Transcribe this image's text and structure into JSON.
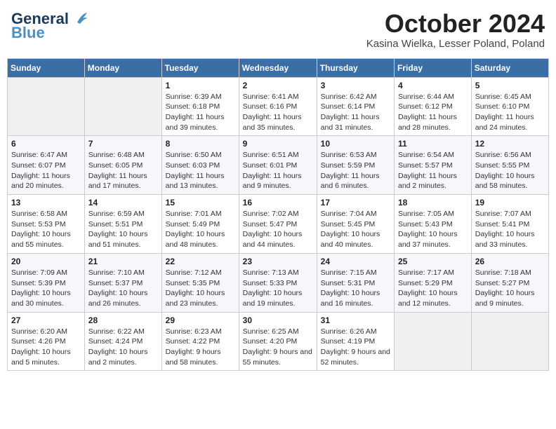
{
  "header": {
    "logo_general": "General",
    "logo_blue": "Blue",
    "month": "October 2024",
    "location": "Kasina Wielka, Lesser Poland, Poland"
  },
  "weekdays": [
    "Sunday",
    "Monday",
    "Tuesday",
    "Wednesday",
    "Thursday",
    "Friday",
    "Saturday"
  ],
  "weeks": [
    [
      {
        "day": "",
        "sunrise": "",
        "sunset": "",
        "daylight": ""
      },
      {
        "day": "",
        "sunrise": "",
        "sunset": "",
        "daylight": ""
      },
      {
        "day": "1",
        "sunrise": "Sunrise: 6:39 AM",
        "sunset": "Sunset: 6:18 PM",
        "daylight": "Daylight: 11 hours and 39 minutes."
      },
      {
        "day": "2",
        "sunrise": "Sunrise: 6:41 AM",
        "sunset": "Sunset: 6:16 PM",
        "daylight": "Daylight: 11 hours and 35 minutes."
      },
      {
        "day": "3",
        "sunrise": "Sunrise: 6:42 AM",
        "sunset": "Sunset: 6:14 PM",
        "daylight": "Daylight: 11 hours and 31 minutes."
      },
      {
        "day": "4",
        "sunrise": "Sunrise: 6:44 AM",
        "sunset": "Sunset: 6:12 PM",
        "daylight": "Daylight: 11 hours and 28 minutes."
      },
      {
        "day": "5",
        "sunrise": "Sunrise: 6:45 AM",
        "sunset": "Sunset: 6:10 PM",
        "daylight": "Daylight: 11 hours and 24 minutes."
      }
    ],
    [
      {
        "day": "6",
        "sunrise": "Sunrise: 6:47 AM",
        "sunset": "Sunset: 6:07 PM",
        "daylight": "Daylight: 11 hours and 20 minutes."
      },
      {
        "day": "7",
        "sunrise": "Sunrise: 6:48 AM",
        "sunset": "Sunset: 6:05 PM",
        "daylight": "Daylight: 11 hours and 17 minutes."
      },
      {
        "day": "8",
        "sunrise": "Sunrise: 6:50 AM",
        "sunset": "Sunset: 6:03 PM",
        "daylight": "Daylight: 11 hours and 13 minutes."
      },
      {
        "day": "9",
        "sunrise": "Sunrise: 6:51 AM",
        "sunset": "Sunset: 6:01 PM",
        "daylight": "Daylight: 11 hours and 9 minutes."
      },
      {
        "day": "10",
        "sunrise": "Sunrise: 6:53 AM",
        "sunset": "Sunset: 5:59 PM",
        "daylight": "Daylight: 11 hours and 6 minutes."
      },
      {
        "day": "11",
        "sunrise": "Sunrise: 6:54 AM",
        "sunset": "Sunset: 5:57 PM",
        "daylight": "Daylight: 11 hours and 2 minutes."
      },
      {
        "day": "12",
        "sunrise": "Sunrise: 6:56 AM",
        "sunset": "Sunset: 5:55 PM",
        "daylight": "Daylight: 10 hours and 58 minutes."
      }
    ],
    [
      {
        "day": "13",
        "sunrise": "Sunrise: 6:58 AM",
        "sunset": "Sunset: 5:53 PM",
        "daylight": "Daylight: 10 hours and 55 minutes."
      },
      {
        "day": "14",
        "sunrise": "Sunrise: 6:59 AM",
        "sunset": "Sunset: 5:51 PM",
        "daylight": "Daylight: 10 hours and 51 minutes."
      },
      {
        "day": "15",
        "sunrise": "Sunrise: 7:01 AM",
        "sunset": "Sunset: 5:49 PM",
        "daylight": "Daylight: 10 hours and 48 minutes."
      },
      {
        "day": "16",
        "sunrise": "Sunrise: 7:02 AM",
        "sunset": "Sunset: 5:47 PM",
        "daylight": "Daylight: 10 hours and 44 minutes."
      },
      {
        "day": "17",
        "sunrise": "Sunrise: 7:04 AM",
        "sunset": "Sunset: 5:45 PM",
        "daylight": "Daylight: 10 hours and 40 minutes."
      },
      {
        "day": "18",
        "sunrise": "Sunrise: 7:05 AM",
        "sunset": "Sunset: 5:43 PM",
        "daylight": "Daylight: 10 hours and 37 minutes."
      },
      {
        "day": "19",
        "sunrise": "Sunrise: 7:07 AM",
        "sunset": "Sunset: 5:41 PM",
        "daylight": "Daylight: 10 hours and 33 minutes."
      }
    ],
    [
      {
        "day": "20",
        "sunrise": "Sunrise: 7:09 AM",
        "sunset": "Sunset: 5:39 PM",
        "daylight": "Daylight: 10 hours and 30 minutes."
      },
      {
        "day": "21",
        "sunrise": "Sunrise: 7:10 AM",
        "sunset": "Sunset: 5:37 PM",
        "daylight": "Daylight: 10 hours and 26 minutes."
      },
      {
        "day": "22",
        "sunrise": "Sunrise: 7:12 AM",
        "sunset": "Sunset: 5:35 PM",
        "daylight": "Daylight: 10 hours and 23 minutes."
      },
      {
        "day": "23",
        "sunrise": "Sunrise: 7:13 AM",
        "sunset": "Sunset: 5:33 PM",
        "daylight": "Daylight: 10 hours and 19 minutes."
      },
      {
        "day": "24",
        "sunrise": "Sunrise: 7:15 AM",
        "sunset": "Sunset: 5:31 PM",
        "daylight": "Daylight: 10 hours and 16 minutes."
      },
      {
        "day": "25",
        "sunrise": "Sunrise: 7:17 AM",
        "sunset": "Sunset: 5:29 PM",
        "daylight": "Daylight: 10 hours and 12 minutes."
      },
      {
        "day": "26",
        "sunrise": "Sunrise: 7:18 AM",
        "sunset": "Sunset: 5:27 PM",
        "daylight": "Daylight: 10 hours and 9 minutes."
      }
    ],
    [
      {
        "day": "27",
        "sunrise": "Sunrise: 6:20 AM",
        "sunset": "Sunset: 4:26 PM",
        "daylight": "Daylight: 10 hours and 5 minutes."
      },
      {
        "day": "28",
        "sunrise": "Sunrise: 6:22 AM",
        "sunset": "Sunset: 4:24 PM",
        "daylight": "Daylight: 10 hours and 2 minutes."
      },
      {
        "day": "29",
        "sunrise": "Sunrise: 6:23 AM",
        "sunset": "Sunset: 4:22 PM",
        "daylight": "Daylight: 9 hours and 58 minutes."
      },
      {
        "day": "30",
        "sunrise": "Sunrise: 6:25 AM",
        "sunset": "Sunset: 4:20 PM",
        "daylight": "Daylight: 9 hours and 55 minutes."
      },
      {
        "day": "31",
        "sunrise": "Sunrise: 6:26 AM",
        "sunset": "Sunset: 4:19 PM",
        "daylight": "Daylight: 9 hours and 52 minutes."
      },
      {
        "day": "",
        "sunrise": "",
        "sunset": "",
        "daylight": ""
      },
      {
        "day": "",
        "sunrise": "",
        "sunset": "",
        "daylight": ""
      }
    ]
  ]
}
